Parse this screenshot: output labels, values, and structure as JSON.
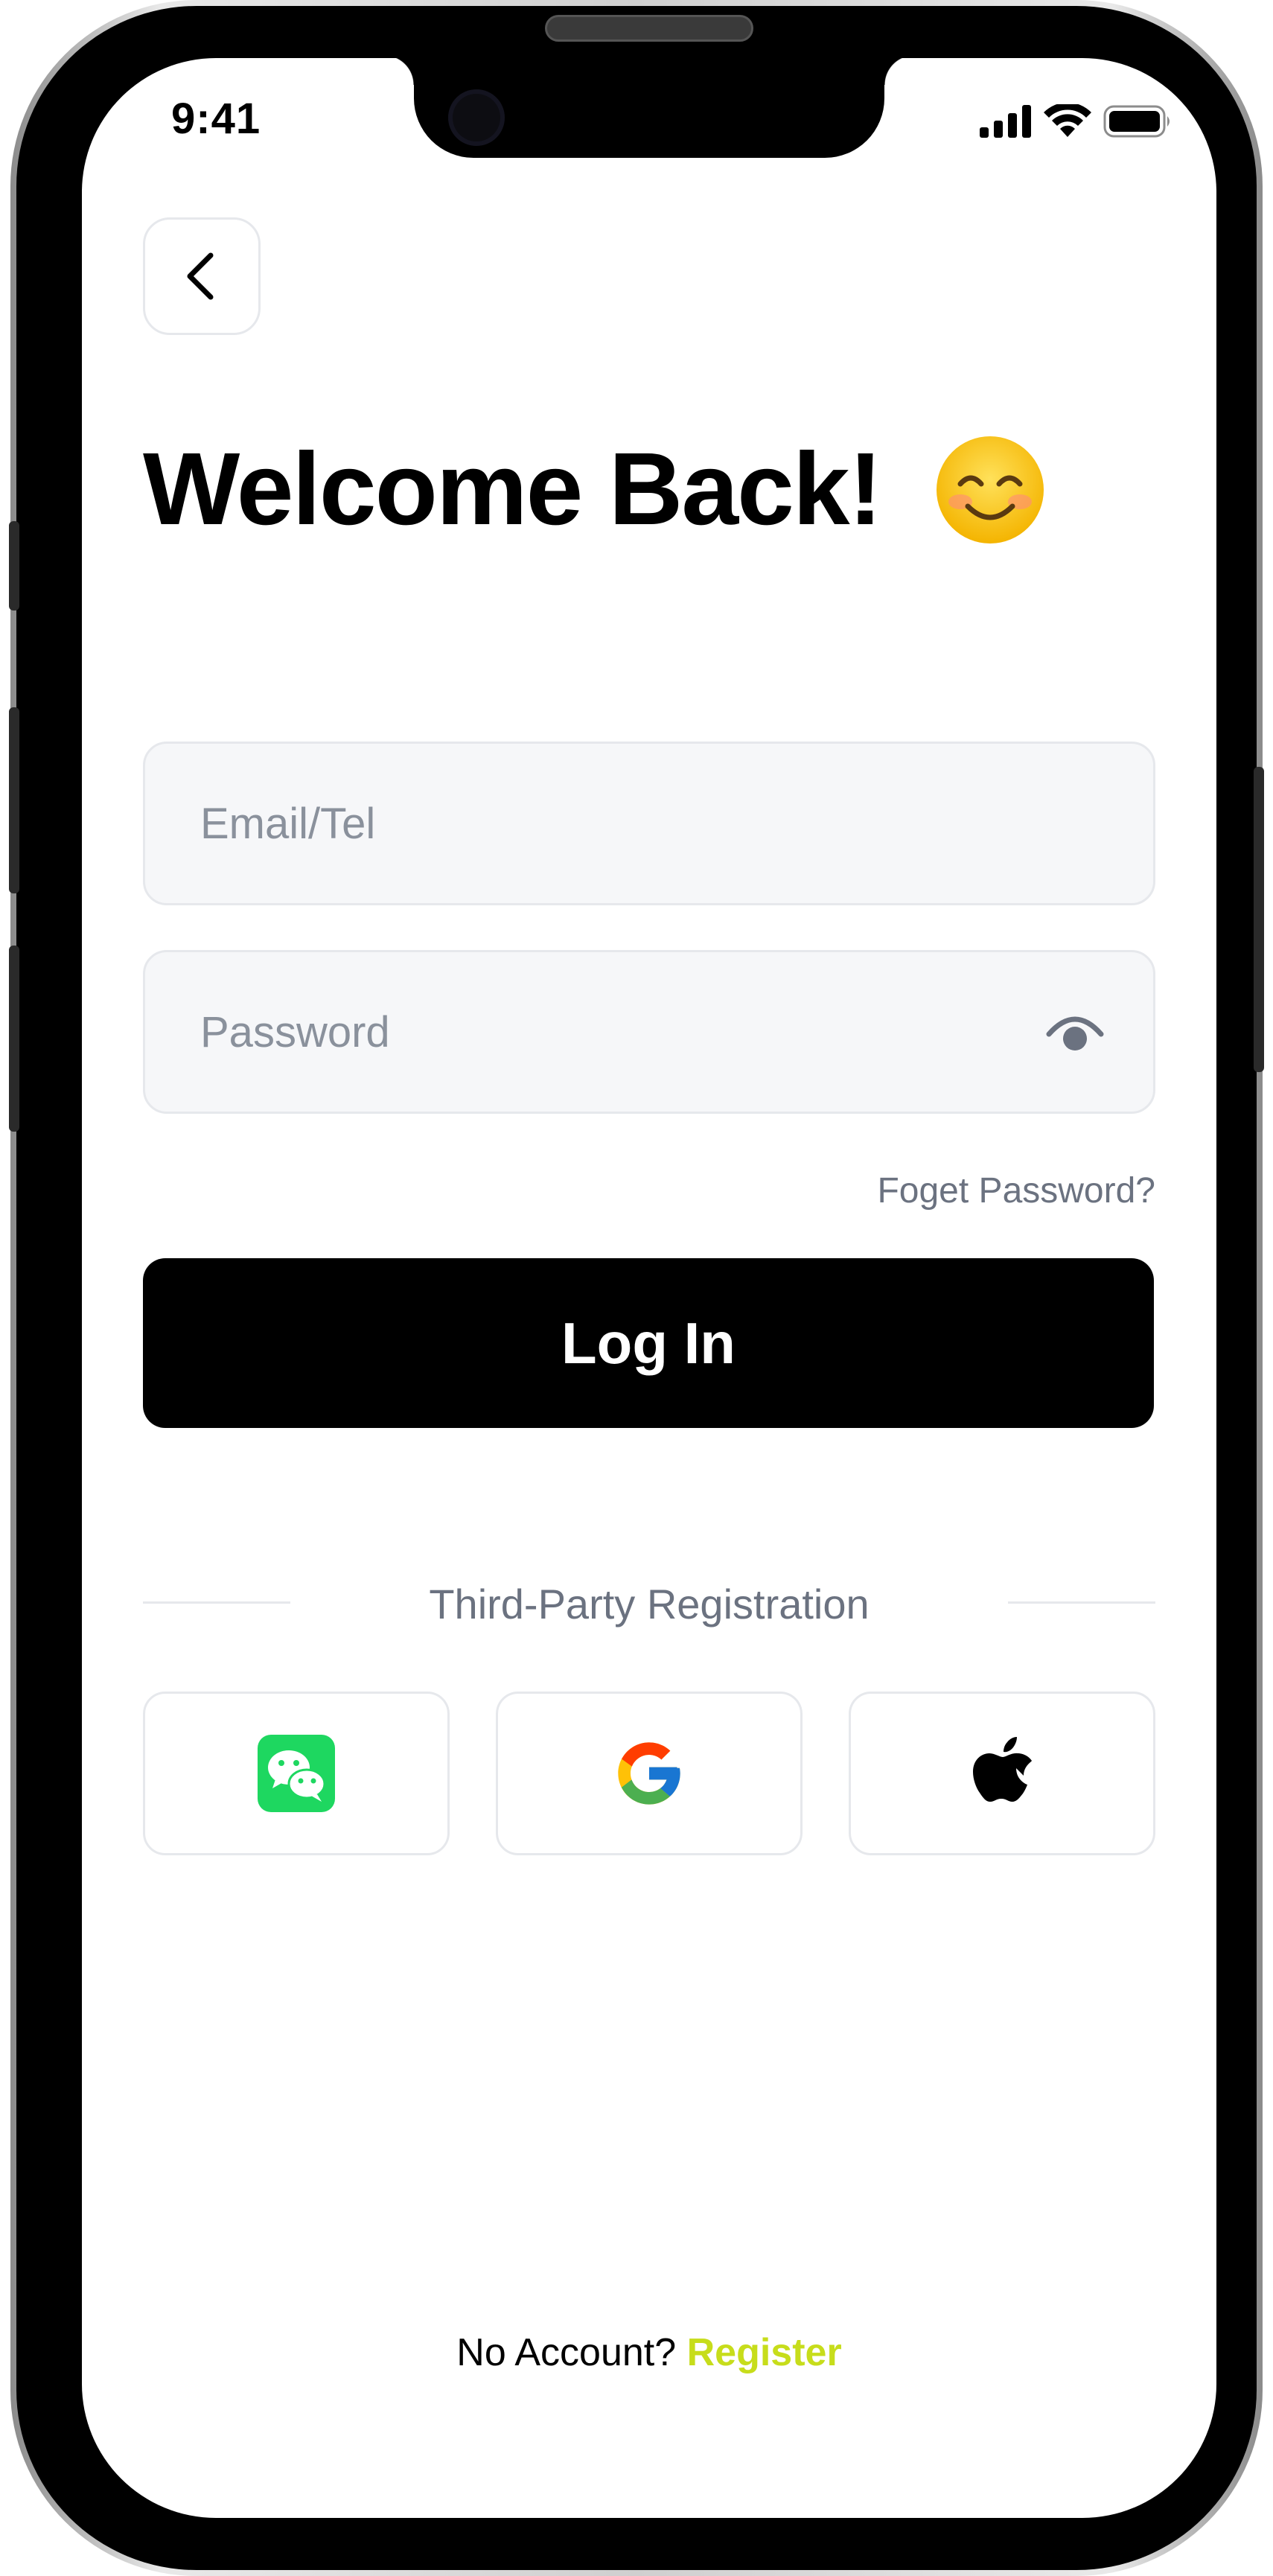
{
  "status_bar": {
    "time": "9:41",
    "icons": [
      "cellular-signal-icon",
      "wifi-icon",
      "battery-icon"
    ]
  },
  "header": {
    "back_icon": "chevron-left-icon",
    "title": "Welcome Back!",
    "title_emoji": "smiling-face-icon"
  },
  "form": {
    "email_placeholder": "Email/Tel",
    "email_value": "",
    "password_placeholder": "Password",
    "password_value": "",
    "password_toggle_icon": "eye-icon",
    "forgot_password_label": "Foget Password?",
    "login_label": "Log In"
  },
  "third_party": {
    "label": "Third-Party Registration",
    "providers": [
      {
        "name": "wechat-icon",
        "color": "#1ED760"
      },
      {
        "name": "google-icon",
        "color": "#4285F4"
      },
      {
        "name": "apple-icon",
        "color": "#000000"
      }
    ]
  },
  "footer": {
    "prompt": "No Account?",
    "register_label": "Register",
    "register_color": "#C7DD1B"
  }
}
